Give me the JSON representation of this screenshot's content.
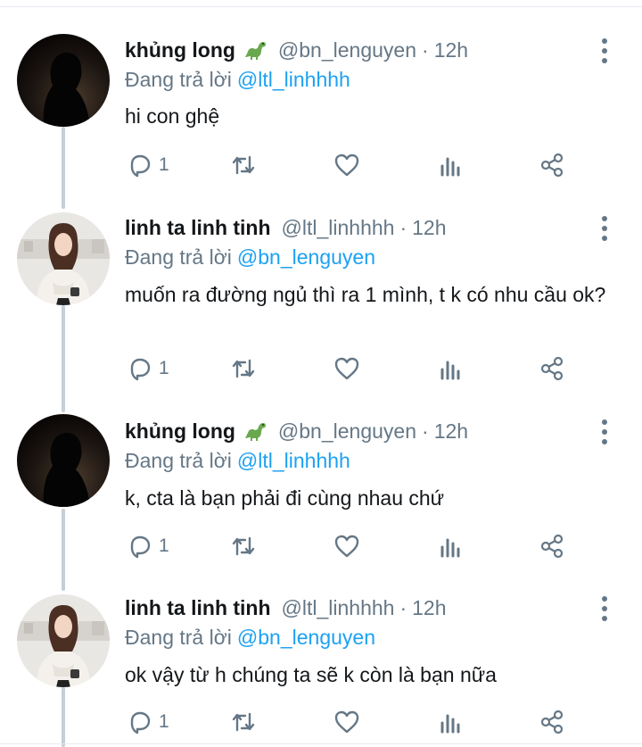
{
  "tweets": [
    {
      "name": "khủng long",
      "has_emoji": true,
      "emoji_icon": "dinosaur-icon",
      "handle": "@bn_lenguyen",
      "time": "12h",
      "reply_prefix": "Đang trả lời",
      "reply_to": "@ltl_linhhhh",
      "text": "hi con ghệ",
      "reply_count": "1",
      "avatar": "dark-silhouette"
    },
    {
      "name": "linh ta linh tinh",
      "has_emoji": false,
      "handle": "@ltl_linhhhh",
      "time": "12h",
      "reply_prefix": "Đang trả lời",
      "reply_to": "@bn_lenguyen",
      "text": "muốn ra đường ngủ thì ra 1 mình, t k có nhu cầu ok?",
      "reply_count": "1",
      "avatar": "girl-photo"
    },
    {
      "name": "khủng long",
      "has_emoji": true,
      "emoji_icon": "dinosaur-icon",
      "handle": "@bn_lenguyen",
      "time": "12h",
      "reply_prefix": "Đang trả lời",
      "reply_to": "@ltl_linhhhh",
      "text": "k, cta là bạn phải đi cùng nhau chứ",
      "reply_count": "1",
      "avatar": "dark-silhouette"
    },
    {
      "name": "linh ta linh tinh",
      "has_emoji": false,
      "handle": "@ltl_linhhhh",
      "time": "12h",
      "reply_prefix": "Đang trả lời",
      "reply_to": "@bn_lenguyen",
      "text": "ok vậy từ h chúng ta sẽ k còn là bạn nữa",
      "reply_count": "1",
      "avatar": "girl-photo"
    }
  ],
  "dot_separator": "·",
  "colors": {
    "text": "#14171a",
    "secondary": "#657786",
    "mention": "#1da1f2",
    "thread_line": "#c4cfd6"
  },
  "icons": [
    "reply-icon",
    "retweet-icon",
    "like-icon",
    "stats-icon",
    "share-icon",
    "more-icon"
  ]
}
